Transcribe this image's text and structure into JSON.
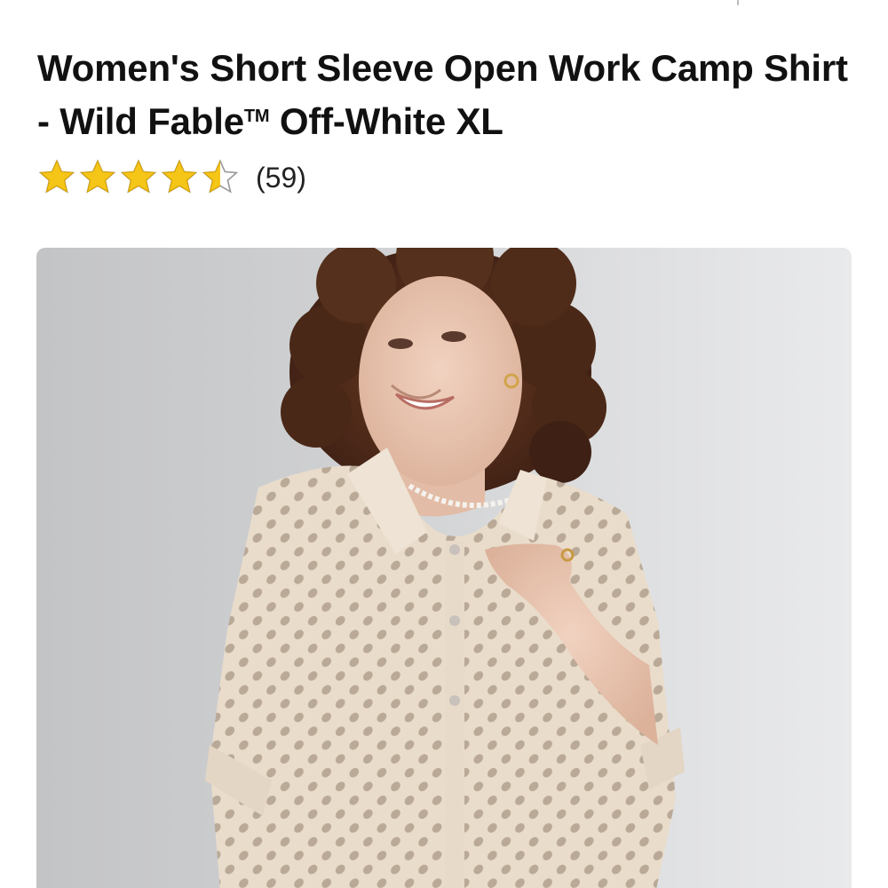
{
  "product": {
    "title_main": "Women's Short Sleeve Open Work Camp Shirt - Wild Fable",
    "title_trademark": "TM",
    "title_suffix": " Off-White XL",
    "rating": {
      "value": 4.5,
      "max": 5,
      "review_count_text": "(59)",
      "star_color": "#f5c518",
      "star_outline": "#9a9a9a"
    },
    "image": {
      "icon": "product-photo",
      "background_color": "#d4d5d7"
    }
  }
}
